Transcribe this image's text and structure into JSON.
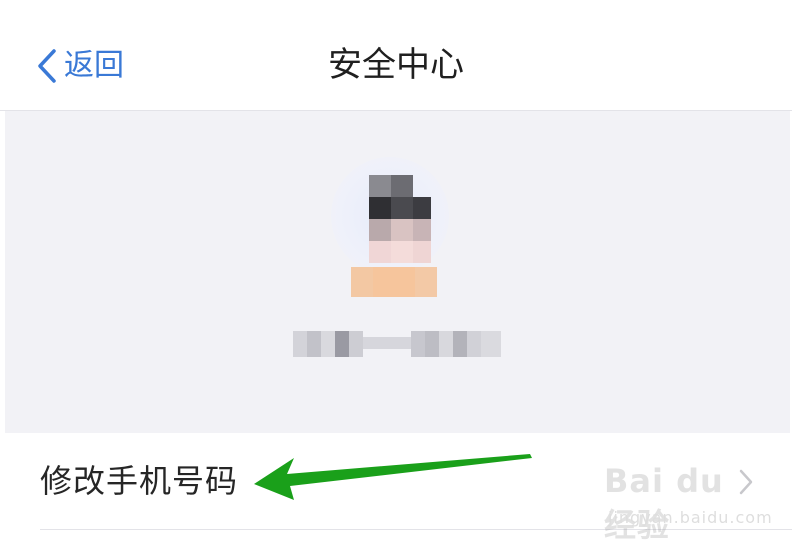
{
  "navbar": {
    "back_label": "返回",
    "title": "安全中心",
    "accent_color": "#3a79d6",
    "back_icon": "chevron-left-icon"
  },
  "profile": {
    "avatar": "pixelated-avatar",
    "username": "obscured"
  },
  "menu": {
    "items": [
      {
        "label": "修改手机号码",
        "icon": "chevron-right-icon"
      }
    ]
  },
  "annotation": {
    "icon": "arrow-icon",
    "color": "#1aa01a"
  },
  "watermark": {
    "logo_text": "Bai du 经验",
    "url": "jingyan.baidu.com"
  }
}
